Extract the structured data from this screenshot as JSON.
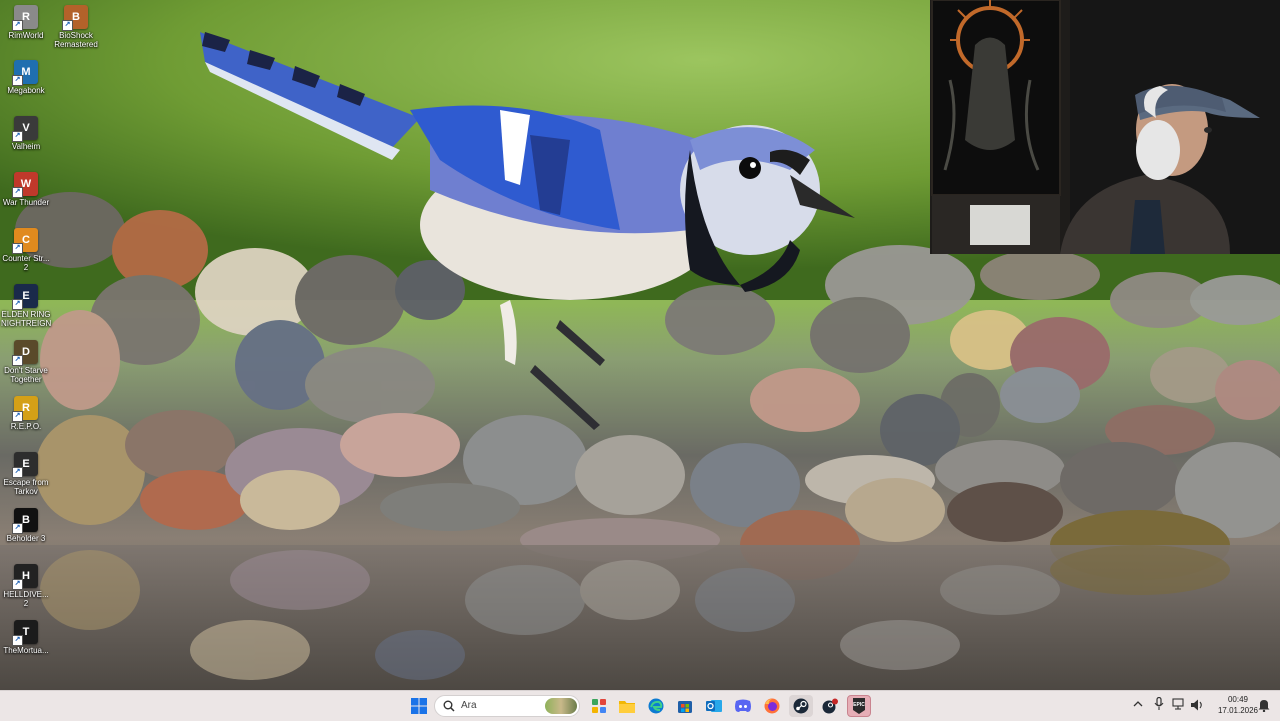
{
  "desktop": {
    "icons": [
      {
        "label": "RimWorld",
        "color": "#8a8a8a",
        "glyph": "R"
      },
      {
        "label": "BioShock Remastered",
        "color": "#b3622a",
        "glyph": "B"
      },
      {
        "label": "Megabonk",
        "color": "#1f6fb0",
        "glyph": "M"
      },
      {
        "label": "Valheim",
        "color": "#3a3a3a",
        "glyph": "V"
      },
      {
        "label": "War Thunder",
        "color": "#c0392b",
        "glyph": "W"
      },
      {
        "label": "Counter Str... 2",
        "color": "#e08a1e",
        "glyph": "C"
      },
      {
        "label": "ELDEN RING NIGHTREIGN",
        "color": "#1a2a4a",
        "glyph": "E"
      },
      {
        "label": "Don't Starve Together",
        "color": "#5a4a2a",
        "glyph": "D"
      },
      {
        "label": "R.E.P.O.",
        "color": "#d4a017",
        "glyph": "R"
      },
      {
        "label": "Escape from Tarkov",
        "color": "#2d2d2d",
        "glyph": "E"
      },
      {
        "label": "Beholder 3",
        "color": "#111111",
        "glyph": "B"
      },
      {
        "label": "HELLDIVE... 2",
        "color": "#222222",
        "glyph": "H"
      },
      {
        "label": "TheMortua...",
        "color": "#1b1b1b",
        "glyph": "T"
      }
    ]
  },
  "taskbar": {
    "search_placeholder": "Ara",
    "pinned": [
      {
        "name": "start-button",
        "color": "#1a73e8"
      },
      {
        "name": "widgets-button",
        "color": "#3ba55c"
      },
      {
        "name": "file-explorer-button",
        "color": "#f2b705"
      },
      {
        "name": "edge-button",
        "color": "#0c7bd1"
      },
      {
        "name": "ms-store-button",
        "color": "#1f5fa8"
      },
      {
        "name": "outlook-button",
        "color": "#0f6cbd"
      },
      {
        "name": "discord-button",
        "color": "#5865f2"
      },
      {
        "name": "firefox-button",
        "color": "#ff7139"
      },
      {
        "name": "steam-button",
        "color": "#1b2838"
      },
      {
        "name": "steam-alt-button",
        "color": "#c62828"
      },
      {
        "name": "epic-games-button",
        "color": "#2b2b2b"
      }
    ],
    "clock": {
      "time": "00:49",
      "date": "17.01.2026"
    }
  }
}
